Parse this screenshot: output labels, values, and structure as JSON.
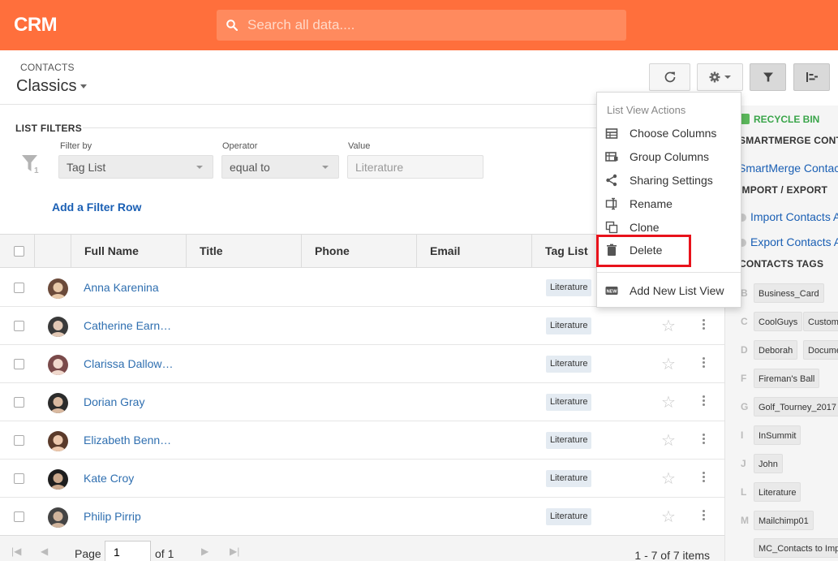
{
  "app": {
    "brand": "CRM"
  },
  "search": {
    "placeholder": "Search all data...."
  },
  "header": {
    "breadcrumb": "CONTACTS",
    "view_name": "Classics"
  },
  "filters": {
    "title": "LIST FILTERS",
    "filter_by_label": "Filter by",
    "filter_by_value": "Tag List",
    "operator_label": "Operator",
    "operator_value": "equal to",
    "value_label": "Value",
    "value_value": "Literature",
    "funnel_count": "1",
    "add_row": "Add a Filter Row"
  },
  "table": {
    "columns": [
      "Full Name",
      "Title",
      "Phone",
      "Email",
      "Tag List"
    ],
    "rows": [
      {
        "name": "Anna Karenina",
        "tag": "Literature"
      },
      {
        "name": "Catherine Earn…",
        "tag": "Literature"
      },
      {
        "name": "Clarissa Dallow…",
        "tag": "Literature"
      },
      {
        "name": "Dorian Gray",
        "tag": "Literature"
      },
      {
        "name": "Elizabeth Benn…",
        "tag": "Literature"
      },
      {
        "name": "Kate Croy",
        "tag": "Literature"
      },
      {
        "name": "Philip Pirrip",
        "tag": "Literature"
      }
    ]
  },
  "pager": {
    "page_label": "Page",
    "page_value": "1",
    "of_label": "of 1",
    "items": "1 - 7 of 7 items"
  },
  "dropdown": {
    "header": "List View Actions",
    "items": [
      {
        "label": "Choose Columns",
        "icon": "table-icon"
      },
      {
        "label": "Group Columns",
        "icon": "group-table-icon"
      },
      {
        "label": "Sharing Settings",
        "icon": "share-icon"
      },
      {
        "label": "Rename",
        "icon": "rename-icon"
      },
      {
        "label": "Clone",
        "icon": "clone-icon"
      },
      {
        "label": "Delete",
        "icon": "trash-icon"
      },
      {
        "label": "Add New List View",
        "icon": "new-badge-icon"
      }
    ]
  },
  "sidebar": {
    "recycle_bin": "RECYCLE BIN",
    "smartmerge_head": "SMARTMERGE CONT",
    "smartmerge_link": "SmartMerge Contacts",
    "import_head": "IMPORT / EXPORT",
    "import_link": "Import Contacts A",
    "export_link": "Export Contacts A",
    "tags_head": "CONTACTS TAGS",
    "tags": [
      {
        "letter": "B",
        "items": [
          "Business_Card"
        ]
      },
      {
        "letter": "C",
        "items": [
          "CoolGuys",
          "Custom"
        ]
      },
      {
        "letter": "D",
        "items": [
          "Deborah",
          "Docume"
        ]
      },
      {
        "letter": "F",
        "items": [
          "Fireman's Ball"
        ]
      },
      {
        "letter": "G",
        "items": [
          "Golf_Tourney_2017"
        ]
      },
      {
        "letter": "I",
        "items": [
          "InSummit"
        ]
      },
      {
        "letter": "J",
        "items": [
          "John"
        ]
      },
      {
        "letter": "L",
        "items": [
          "Literature"
        ]
      },
      {
        "letter": "M",
        "items": [
          "Mailchimp01"
        ]
      },
      {
        "letter": "",
        "items": [
          "MC_Contacts to Imp"
        ]
      }
    ]
  },
  "colors": {
    "brand": "#ff6f3c",
    "link": "#2f6fb0",
    "highlight": "#e8121b"
  }
}
